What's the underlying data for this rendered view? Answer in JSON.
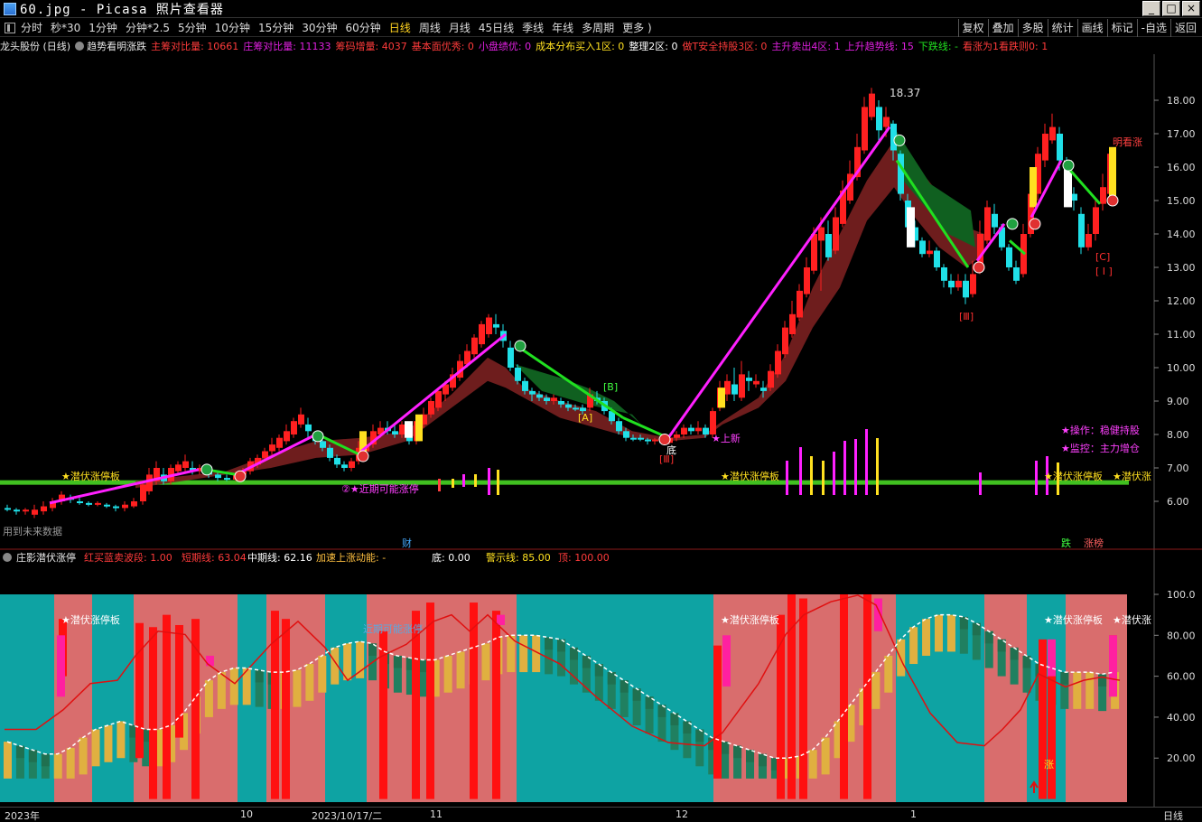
{
  "window": {
    "title": "60.jpg - Picasa 照片查看器",
    "buttons": [
      "_",
      "□",
      "×"
    ]
  },
  "toolbar": {
    "periods": [
      "分时",
      "秒*30",
      "1分钟",
      "分钟*2.5",
      "5分钟",
      "10分钟",
      "15分钟",
      "30分钟",
      "60分钟",
      "日线",
      "周线",
      "月线",
      "45日线",
      "季线",
      "年线",
      "多周期",
      "更多 )"
    ],
    "active": "日线",
    "right": [
      "复权",
      "叠加",
      "多股",
      "统计",
      "画线",
      "标记",
      "-自选",
      "返回"
    ]
  },
  "infobar": {
    "stock": "龙头股份 (日线)",
    "indicator": "趋势看明涨跌",
    "items": [
      {
        "text": "主筹对比量: 10661",
        "color": "#ff3b3b"
      },
      {
        "text": "庄筹对比量: 11133",
        "color": "#e020e0"
      },
      {
        "text": "筹码增量: 4037",
        "color": "#ff3b3b"
      },
      {
        "text": "基本面优秀: 0",
        "color": "#ff3b3b"
      },
      {
        "text": "小盘绩优: 0",
        "color": "#e020e0"
      },
      {
        "text": "成本分布买入1区: 0",
        "color": "#ffe020"
      },
      {
        "text": "整理2区: 0",
        "color": "#ffffff"
      },
      {
        "text": "做T安全持股3区: 0",
        "color": "#ff3b3b"
      },
      {
        "text": "主升卖出4区: 1",
        "color": "#e020e0"
      },
      {
        "text": "上升趋势线: 15",
        "color": "#e020e0"
      },
      {
        "text": "下跌线: -",
        "color": "#20e020"
      },
      {
        "text": "看涨为1看跌则0: 1",
        "color": "#ff3b3b"
      }
    ]
  },
  "price_axis": [
    "18.00",
    "17.00",
    "16.00",
    "15.00",
    "14.00",
    "13.00",
    "12.00",
    "11.00",
    "10.00",
    "9.00",
    "8.00",
    "7.00",
    "6.00"
  ],
  "sub_axis": [
    "100.0",
    "80.00",
    "60.00",
    "40.00",
    "20.00"
  ],
  "annotations": {
    "high": "18.37",
    "side_op": "★操作：稳健持股",
    "side_mon": "★监控：主力增仓",
    "future": "用到未来数据",
    "cai": "财",
    "die": "跌",
    "zhangting": "涨榜",
    "qianfu": "★潜伏涨停板",
    "qianfu_short": "★潜伏涨",
    "jinqi": "②★近期可能涨停",
    "shangxin": "★上新",
    "mingkanzhang": "明看涨",
    "zhang": "涨",
    "di": "底",
    "A": "[A]",
    "B": "[B]",
    "C": "[C]",
    "I": "[ I ]",
    "III": "[Ⅲ]"
  },
  "subpanel": {
    "name": "庄影潜伏涨停",
    "items": [
      {
        "text": "红买蓝卖波段: 1.00",
        "color": "#ff3b3b"
      },
      {
        "text": "短期线: 63.04",
        "color": "#ff3b3b"
      },
      {
        "text": "中期线: 62.16",
        "color": "#ffffff"
      },
      {
        "text": "加速上涨动能: -",
        "color": "#ffc040"
      },
      {
        "text": "底: 0.00",
        "color": "#ffffff"
      },
      {
        "text": "警示线: 85.00",
        "color": "#ffe020"
      },
      {
        "text": "顶: 100.00",
        "color": "#ff3b3b"
      }
    ],
    "mid_label": "近期可能涨停"
  },
  "time_axis": [
    "2023年",
    "10",
    "2023/10/17/二",
    "11",
    "12",
    "1"
  ],
  "period_label": "日线",
  "colors": {
    "up": "#ff2020",
    "down": "#20e0e8",
    "pink": "#ff8080",
    "teal": "#10c0c0",
    "magenta": "#ff20ff",
    "green": "#20e020",
    "cloud_red": "#7a2020",
    "cloud_green": "#106020",
    "yellow": "#ffe020"
  }
}
